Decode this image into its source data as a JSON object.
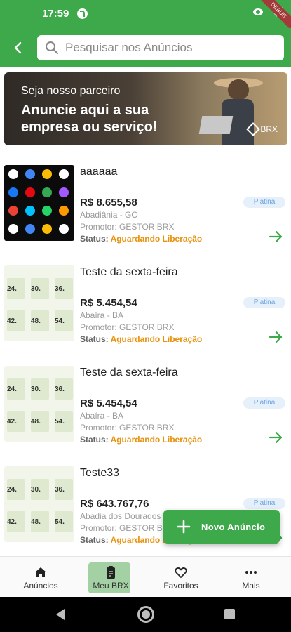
{
  "status_bar": {
    "time": "17:59",
    "debug_label": "DEBUG"
  },
  "search": {
    "placeholder": "Pesquisar nos Anúncios"
  },
  "banner": {
    "subtitle": "Seja nosso parceiro",
    "title": "Anuncie aqui a sua empresa ou serviço!",
    "brand": "BRX"
  },
  "ads": [
    {
      "name": "aaaaaa",
      "price": "R$ 8.655,58",
      "location": "Abadiânia - GO",
      "promoter": "Promotor: GESTOR BRX",
      "status_label": "Status:",
      "status_value": "Aguardando Liberação",
      "badge": "Platina",
      "thumb": "apps"
    },
    {
      "name": "Teste da sexta-feira",
      "price": "R$ 5.454,54",
      "location": "Abaíra - BA",
      "promoter": "Promotor: GESTOR BRX",
      "status_label": "Status:",
      "status_value": "Aguardando Liberação",
      "badge": "Platina",
      "thumb": "table"
    },
    {
      "name": "Teste da sexta-feira",
      "price": "R$ 5.454,54",
      "location": "Abaíra - BA",
      "promoter": "Promotor: GESTOR BRX",
      "status_label": "Status:",
      "status_value": "Aguardando Liberação",
      "badge": "Platina",
      "thumb": "table"
    },
    {
      "name": "Teste33",
      "price": "R$ 643.767,76",
      "location": "Abadia dos Dourados",
      "promoter": "Promotor: GESTOR BRX",
      "status_label": "Status:",
      "status_value": "Aguardando Liberação",
      "badge": "Platina",
      "thumb": "table"
    }
  ],
  "thumb_table_numbers": [
    "24.",
    "30.",
    "36.",
    "42.",
    "48.",
    "54."
  ],
  "fab": {
    "label": "Novo Anúncio"
  },
  "bottom_nav": [
    {
      "label": "Anúncios",
      "icon": "home-icon"
    },
    {
      "label": "Meu BRX",
      "icon": "clipboard-icon",
      "active": true
    },
    {
      "label": "Favoritos",
      "icon": "heart-icon"
    },
    {
      "label": "Mais",
      "icon": "more-icon"
    }
  ],
  "colors": {
    "primary": "#3ea94a",
    "status_value": "#e8910c",
    "badge_bg": "#e6f0fb",
    "badge_text": "#6aa3e0",
    "nav_active": "#a4d1a4"
  }
}
